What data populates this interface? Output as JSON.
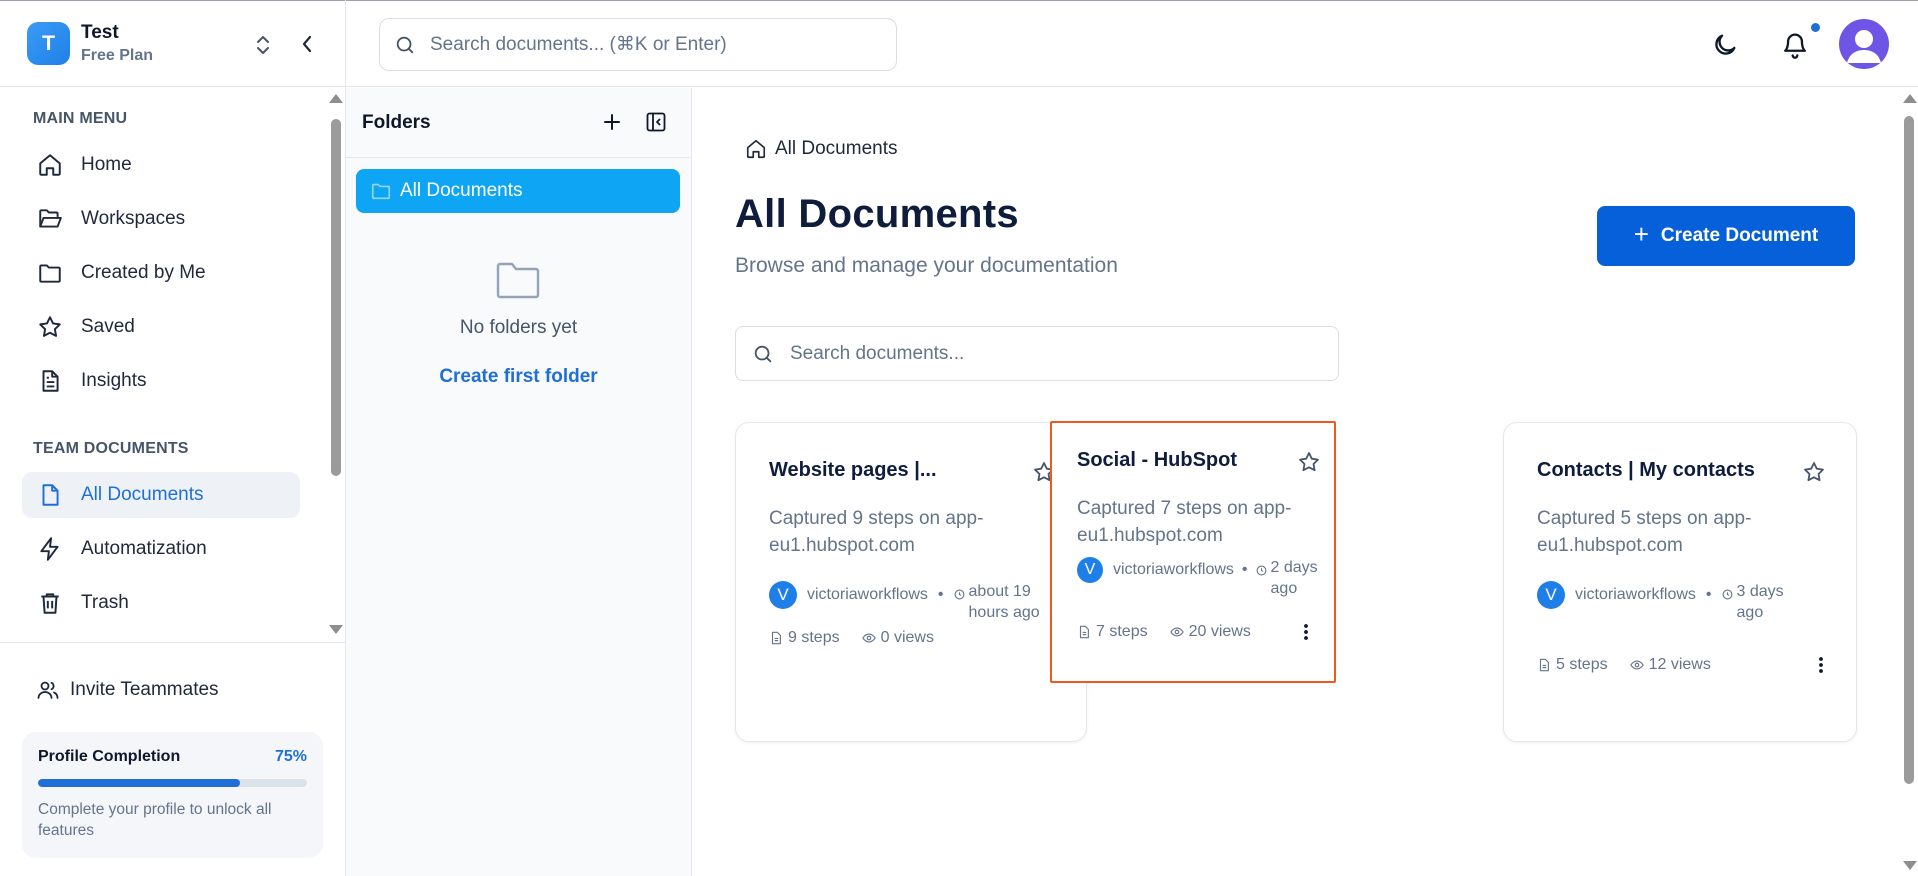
{
  "workspace": {
    "logo_letter": "T",
    "name": "Test",
    "plan": "Free Plan"
  },
  "sidebar": {
    "main_menu_title": "MAIN MENU",
    "main_items": [
      {
        "label": "Home",
        "icon": "home-icon"
      },
      {
        "label": "Workspaces",
        "icon": "folder-open-icon"
      },
      {
        "label": "Created by Me",
        "icon": "folder-icon"
      },
      {
        "label": "Saved",
        "icon": "star-icon"
      },
      {
        "label": "Insights",
        "icon": "document-icon"
      }
    ],
    "team_title": "TEAM DOCUMENTS",
    "team_items": [
      {
        "label": "All Documents",
        "icon": "file-icon",
        "active": true
      },
      {
        "label": "Automatization",
        "icon": "lightning-icon"
      },
      {
        "label": "Trash",
        "icon": "trash-icon"
      }
    ],
    "invite_label": "Invite Teammates",
    "profile": {
      "title": "Profile Completion",
      "percent_label": "75%",
      "progress": 0.75,
      "description": "Complete your profile to unlock all features"
    }
  },
  "topbar": {
    "search_placeholder": "Search documents... (⌘K or Enter)",
    "notification_dot_color": "#1f6fd6",
    "avatar_color": "#6f55e6"
  },
  "folders": {
    "title": "Folders",
    "items": [
      {
        "label": "All Documents",
        "active": true
      }
    ],
    "empty_text": "No folders yet",
    "create_link": "Create first folder"
  },
  "main": {
    "breadcrumb": "All Documents",
    "title": "All Documents",
    "subtitle": "Browse and manage your documentation",
    "create_button": "Create Document",
    "search_placeholder": "Search documents...",
    "accent_color": "#0660d9",
    "highlight_color": "#ef5a1c"
  },
  "documents": [
    {
      "title": "Website pages |...",
      "description": "Captured 9 steps on app-eu1.hubspot.com",
      "avatar_letter": "V",
      "author": "victoriaworkflows",
      "time": "about 19 hours ago",
      "steps": "9 steps",
      "views": "0 views",
      "highlighted": false
    },
    {
      "title": "Social - HubSpot",
      "description": "Captured 7 steps on app-eu1.hubspot.com",
      "avatar_letter": "V",
      "author": "victoriaworkflows",
      "time": "2 days ago",
      "steps": "7 steps",
      "views": "20 views",
      "highlighted": true
    },
    {
      "title": "Contacts | My contacts",
      "description": "Captured 5 steps on app-eu1.hubspot.com",
      "avatar_letter": "V",
      "author": "victoriaworkflows",
      "time": "3 days ago",
      "steps": "5 steps",
      "views": "12 views",
      "highlighted": false
    }
  ]
}
